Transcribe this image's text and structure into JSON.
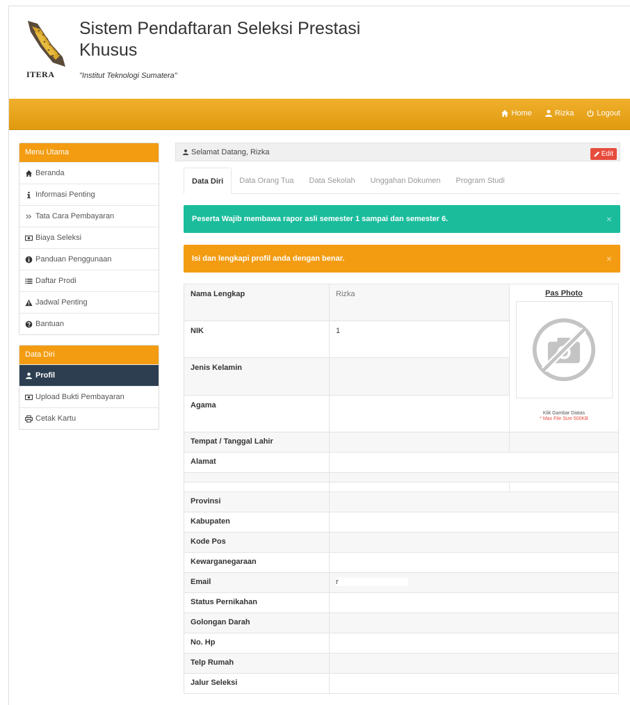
{
  "header": {
    "logo_text": "ITERA",
    "title": "Sistem Pendaftaran Seleksi Prestasi Khusus",
    "subtitle": "\"Institut Teknologi Sumatera\""
  },
  "topnav": {
    "home": "Home",
    "user": "Rizka",
    "logout": "Logout"
  },
  "sidebar": {
    "menu_title": "Menu Utama",
    "items": [
      {
        "label": "Beranda",
        "icon": "home-icon"
      },
      {
        "label": "Informasi Penting",
        "icon": "info-icon"
      },
      {
        "label": "Tata Cara Pembayaran",
        "icon": "double-chevron-icon"
      },
      {
        "label": "Biaya Seleksi",
        "icon": "money-icon"
      },
      {
        "label": "Panduan Penggunaan",
        "icon": "info-circle-icon"
      },
      {
        "label": "Daftar Prodi",
        "icon": "list-icon"
      },
      {
        "label": "Jadwal Penting",
        "icon": "warning-icon"
      },
      {
        "label": "Bantuan",
        "icon": "question-icon"
      }
    ],
    "data_title": "Data Diri",
    "data_items": [
      {
        "label": "Profil",
        "icon": "user-icon"
      },
      {
        "label": "Upload Bukti Pembayaran",
        "icon": "money-icon"
      },
      {
        "label": "Cetak Kartu",
        "icon": "print-icon"
      }
    ]
  },
  "main": {
    "welcome": "Selamat Datang, Rizka",
    "edit_label": "Edit",
    "tabs": [
      "Data Diri",
      "Data Orang Tua",
      "Data Sekolah",
      "Unggahan Dokumen",
      "Program Studi"
    ],
    "alert_teal": "Peserta Wajib membawa rapor asli semester 1 sampai dan semester 6.",
    "alert_orange": "Isi dan lengkapi profil anda dengan benar.",
    "close_glyph": "×"
  },
  "profile": {
    "photo_title": "Pas Photo",
    "photo_hint": "Klik Gambar Diatas",
    "photo_max": "* Max File Size 500KB",
    "rows": [
      {
        "label": "Nama Lengkap",
        "value": "Rizka"
      },
      {
        "label": "NIK",
        "value": "1"
      },
      {
        "label": "Jenis Kelamin",
        "value": ""
      },
      {
        "label": "Agama",
        "value": ""
      },
      {
        "label": "Tempat / Tanggal Lahir",
        "value": ""
      },
      {
        "label": "Alamat",
        "value": ""
      },
      {
        "label": "",
        "value": ""
      },
      {
        "label": "",
        "value": ""
      },
      {
        "label": "Provinsi",
        "value": ""
      },
      {
        "label": "Kabupaten",
        "value": ""
      },
      {
        "label": "Kode Pos",
        "value": ""
      },
      {
        "label": "Kewarganegaraan",
        "value": ""
      },
      {
        "label": "Email",
        "value": "r"
      },
      {
        "label": "Status Pernikahan",
        "value": ""
      },
      {
        "label": "Golongan Darah",
        "value": ""
      },
      {
        "label": "No. Hp",
        "value": ""
      },
      {
        "label": "Telp Rumah",
        "value": ""
      },
      {
        "label": "Jalur Seleksi",
        "value": ""
      }
    ]
  }
}
